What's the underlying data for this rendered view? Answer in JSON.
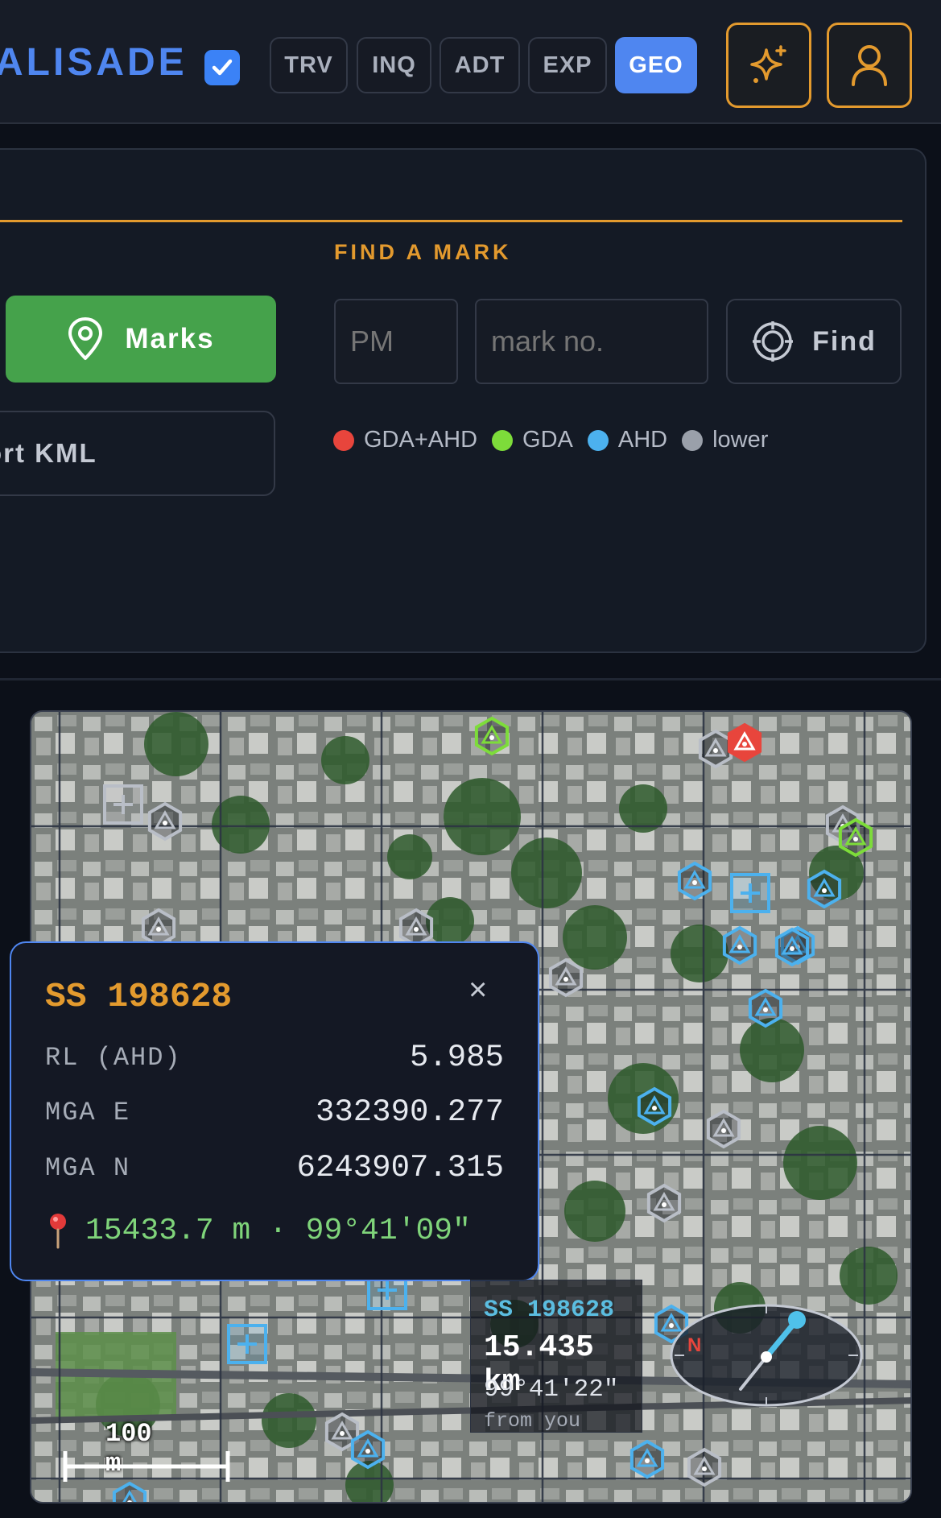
{
  "header": {
    "brand": "ALISADE",
    "tabs": [
      {
        "label": "TRV"
      },
      {
        "label": "INQ"
      },
      {
        "label": "ADT"
      },
      {
        "label": "EXP"
      },
      {
        "label": "GEO",
        "active": true
      }
    ],
    "icons": [
      "sparkle-icon",
      "user-icon"
    ]
  },
  "panel": {
    "marks_button": "Marks",
    "kml_button": "ort KML",
    "find_section_title": "FIND A MARK",
    "pm_placeholder": "PM",
    "mark_placeholder": "mark no.",
    "find_button": "Find",
    "legend": [
      {
        "label": "GDA+AHD",
        "color": "#e8453c"
      },
      {
        "label": "GDA",
        "color": "#7ddc3a"
      },
      {
        "label": "AHD",
        "color": "#4cb1ee"
      },
      {
        "label": "lower",
        "color": "#9aa0aa"
      }
    ]
  },
  "popup": {
    "title": "SS 198628",
    "close": "×",
    "rows": [
      {
        "label": "RL (AHD)",
        "value": "5.985"
      },
      {
        "label": "MGA E",
        "value": "332390.277"
      },
      {
        "label": "MGA N",
        "value": "6243907.315"
      }
    ],
    "footer": "15433.7 m · 99°41'09\""
  },
  "map_label": {
    "id": "SS 198628",
    "distance": "15.435 km",
    "bearing": "99°41'22\"",
    "from": "from you"
  },
  "compass": {
    "north": "N"
  },
  "scale": {
    "label": "100 m"
  }
}
